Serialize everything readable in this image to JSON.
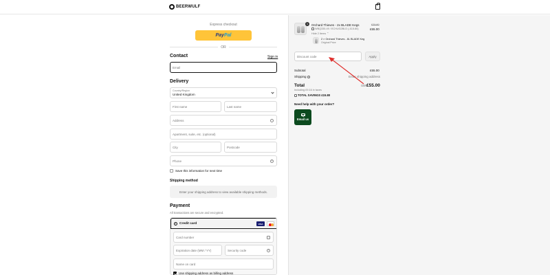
{
  "header": {
    "brand": "BEERWULF"
  },
  "checkout": {
    "express_label": "Express checkout",
    "paypal_part1": "Pay",
    "paypal_part2": "Pal",
    "or": "OR",
    "contact": {
      "title": "Contact",
      "sign_in": "Sign in",
      "email_placeholder": "Email"
    },
    "delivery": {
      "title": "Delivery",
      "country_label": "Country/Region",
      "country_value": "United Kingdom",
      "first_name": "First name",
      "last_name": "Last name",
      "address": "Address",
      "apartment": "Apartment, suite, etc. (optional)",
      "city": "City",
      "postcode": "Postcode",
      "phone": "Phone",
      "save_info": "Save this information for next time"
    },
    "shipping": {
      "title": "Shipping method",
      "message": "Enter your shipping address to view available shipping methods."
    },
    "payment": {
      "title": "Payment",
      "subtitle": "All transactions are secure and encrypted.",
      "credit_card": "Credit card",
      "visa": "VISA",
      "card_number": "Card number",
      "expiration": "Expiration date (MM / YY)",
      "security_code": "Security code",
      "name_on_card": "Name on card",
      "billing_same": "Use shipping address as billing address"
    }
  },
  "summary": {
    "item": {
      "qty": "1",
      "title": "Orchard Thieves - 2x BLADE Kegs",
      "discount_code": "WBQ335.49 / ECHUG2BLD (-£15.80)",
      "details": "Hide 2 items",
      "price_old": "£70.80",
      "price": "£55.00",
      "sub_title": "2 × Orchard Thieves - 8L BLADE Keg",
      "sub_note": "Original Price"
    },
    "discount_placeholder": "Discount code",
    "apply": "Apply",
    "subtotal_label": "Subtotal",
    "subtotal_value": "£55.00",
    "shipping_label": "Shipping",
    "shipping_value": "Enter shipping address",
    "total_label": "Total",
    "total_currency": "GBP",
    "total_value": "£55.00",
    "tax_note": "Including £9.16 in taxes",
    "savings": "TOTAL SAVINGS £15.80",
    "help": "Need help with your order?",
    "email_us": "Email us"
  },
  "colors": {
    "paypal": "#ffc439",
    "email_button": "#0c4a1e",
    "arrow": "#e0312e"
  }
}
